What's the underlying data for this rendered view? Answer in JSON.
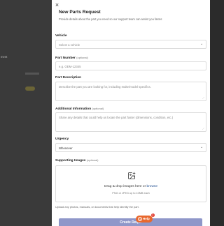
{
  "background": {
    "side_text": "ment"
  },
  "modal": {
    "close_label": "×",
    "title": "New Parts Request",
    "subtitle": "Provide details about the part you need so our support team can assist you faster.",
    "vehicle": {
      "label": "Vehicle",
      "placeholder": "Select a vehicle"
    },
    "part_number": {
      "label": "Part Number",
      "optional": "(optional)",
      "placeholder": "e.g. OEM-12345"
    },
    "part_description": {
      "label": "Part Description",
      "placeholder": "Describe the part you are looking for, including make/model specifics."
    },
    "additional_info": {
      "label": "Additional Information",
      "optional": "(optional)",
      "placeholder": "Share any details that could help us locate the part faster (dimensions, condition, etc.)"
    },
    "urgency": {
      "label": "Urgency",
      "value": "Whenever"
    },
    "images": {
      "label": "Supporting Images",
      "optional": "(optional)",
      "drop_text": "Drag & drop images here or ",
      "browse_text": "browse",
      "hint": "PNG or JPEG up to 10MB each"
    },
    "upload_note": "Upload any photos, manuals, or documents that help identify the part.",
    "submit_label": "Create Req...",
    "help": {
      "label": "Help",
      "badge": "1"
    }
  },
  "colors": {
    "accent": "#8f97c9",
    "help": "#e8682e",
    "link": "#1f4d8f"
  }
}
